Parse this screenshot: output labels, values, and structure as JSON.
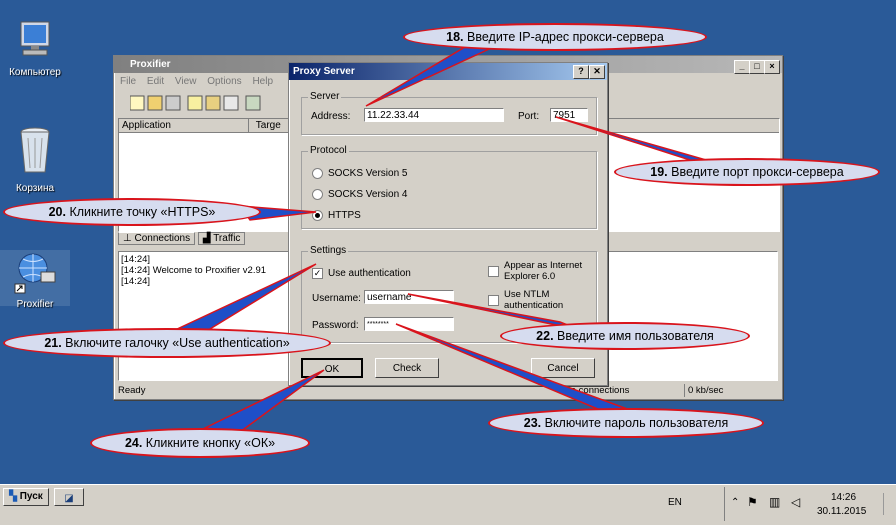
{
  "desktop": {
    "icons": [
      {
        "label": "Компьютер",
        "icon": "computer-icon"
      },
      {
        "label": "Корзина",
        "icon": "recycle-bin-icon"
      },
      {
        "label": "Proxifier",
        "icon": "proxifier-icon"
      }
    ]
  },
  "proxifier": {
    "title": "Proxifier",
    "menu": [
      "File",
      "Edit",
      "View",
      "Options",
      "Help"
    ],
    "columns": [
      "Application",
      "Targe"
    ],
    "tabs": [
      "Connections",
      "Traffic"
    ],
    "log": [
      "[14:24]",
      "[14:24]  Welcome to Proxifier v2.91",
      "[14:24]"
    ],
    "status": {
      "ready": "Ready",
      "connections": "ve connections",
      "speed": "0 kb/sec"
    }
  },
  "dialog": {
    "title": "Proxy Server",
    "server_group": "Server",
    "address_label": "Address:",
    "address_value": "11.22.33.44",
    "port_label": "Port:",
    "port_value": "7951",
    "protocol_group": "Protocol",
    "protocols": [
      {
        "label": "SOCKS Version 5",
        "selected": false
      },
      {
        "label": "SOCKS Version 4",
        "selected": false
      },
      {
        "label": "HTTPS",
        "selected": true
      }
    ],
    "settings_group": "Settings",
    "use_auth_label": "Use authentication",
    "use_auth_checked": true,
    "appear_ie_label_1": "Appear as Internet",
    "appear_ie_label_2": "Explorer 6.0",
    "use_ntlm_label_1": "Use NTLM",
    "use_ntlm_label_2": "authentication",
    "username_label": "Username:",
    "username_value": "username",
    "password_label": "Password:",
    "password_value": "********",
    "ok": "OK",
    "check": "Check",
    "cancel": "Cancel",
    "help_btn": "?",
    "close_btn": "✕"
  },
  "callouts": {
    "c18": {
      "num": "18.",
      "text": " Введите IP-адрес прокси-сервера"
    },
    "c19": {
      "num": "19.",
      "text": " Введите порт прокси-сервера"
    },
    "c20": {
      "num": "20.",
      "text": " Кликните точку «HTTPS»"
    },
    "c21": {
      "num": "21.",
      "text": " Включите галочку «Use authentication»"
    },
    "c22": {
      "num": "22.",
      "text": " Введите имя пользователя"
    },
    "c23": {
      "num": "23.",
      "text": " Включите пароль пользователя"
    },
    "c24": {
      "num": "24.",
      "text": " Кликните кнопку «ОК»"
    }
  },
  "taskbar": {
    "start": "Пуск",
    "lang": "EN",
    "time": "14:26",
    "date": "30.11.2015"
  },
  "colors": {
    "desktop": "#2a5a98",
    "title_active": "#0a246a",
    "title_inactive": "#808080",
    "callout_border": "#d9141c",
    "callout_fill": "#d6dcef"
  }
}
